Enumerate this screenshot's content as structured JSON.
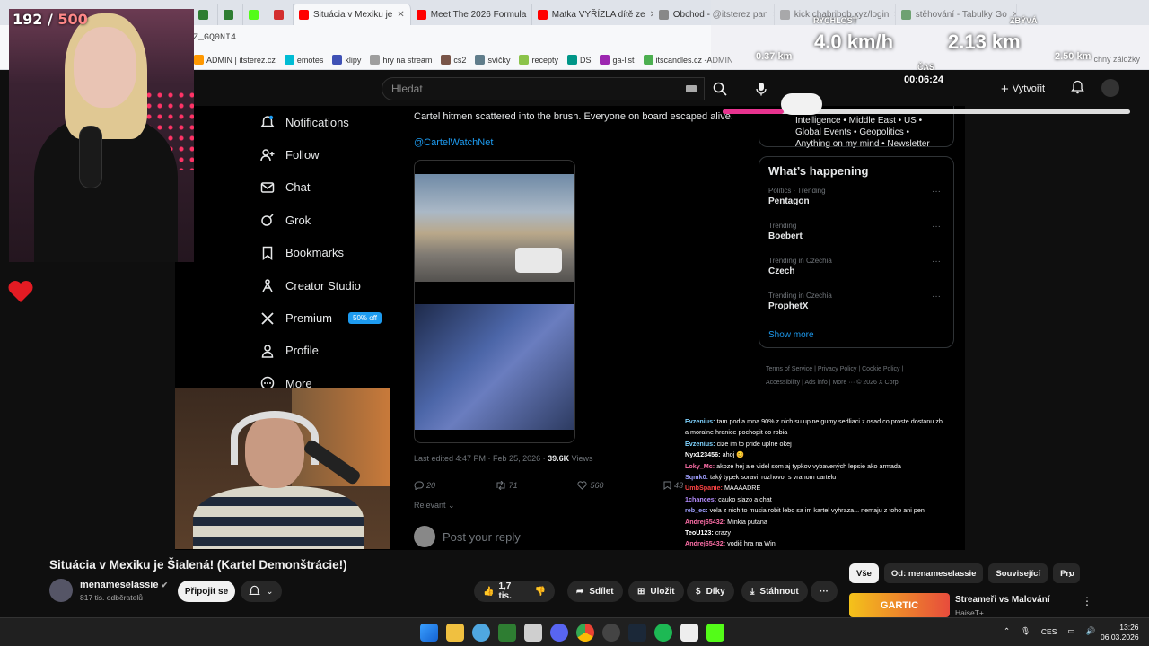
{
  "browser": {
    "tabs": [
      {
        "title": "",
        "color": "#2e7d32"
      },
      {
        "title": "",
        "color": "#2e7d32"
      },
      {
        "title": "",
        "color": "#53fc18"
      },
      {
        "title": "",
        "color": "#d32f2f"
      },
      {
        "title": "Situácia v Mexiku je",
        "color": "#ff0000",
        "active": true
      },
      {
        "title": "Meet The 2026 Formula",
        "color": "#ff0000"
      },
      {
        "title": "Matka VYŘÍZLA dítě ze",
        "color": "#ff0000"
      },
      {
        "title": "Obchod - @itsterez pan",
        "color": "#888888"
      },
      {
        "title": "kick.chabribob.xyz/login",
        "color": "#888888"
      },
      {
        "title": "stěhování - Tabulky Go",
        "color": "#2e7d32"
      }
    ],
    "url_fragment": "Z_GQ0NI4",
    "bookmarks": [
      "ADMIN | itsterez.cz",
      "emotes",
      "klipy",
      "hry na stream",
      "cs2",
      "svíčky",
      "recepty",
      "DS",
      "ga-list",
      "itscandles.cz -ADMIN"
    ],
    "bookmarks_other": "chny záložky"
  },
  "stream_overlay": {
    "counter_current": "192",
    "counter_sep": "/",
    "counter_max": "500",
    "speed_label": "RYCHLOST",
    "speed_value": "4.0 km/h",
    "remaining_label": "ZBÝVÁ",
    "remaining_value": "2.13 km",
    "distance_left": "0.37 km",
    "distance_right": "2.50 km",
    "time_label": "ČAS",
    "time_value": "00:06:24",
    "progress_fraction": 0.15
  },
  "youtube_header": {
    "search_placeholder": "Hledat",
    "create_label": "Vytvořit"
  },
  "x_nav": {
    "items": [
      {
        "label": "Notifications",
        "icon": "bell-icon"
      },
      {
        "label": "Follow",
        "icon": "follow-icon"
      },
      {
        "label": "Chat",
        "icon": "mail-icon"
      },
      {
        "label": "Grok",
        "icon": "grok-icon"
      },
      {
        "label": "Bookmarks",
        "icon": "bookmark-icon"
      },
      {
        "label": "Creator Studio",
        "icon": "creator-icon"
      },
      {
        "label": "Premium",
        "icon": "x-logo-icon",
        "badge": "50% off"
      },
      {
        "label": "Profile",
        "icon": "person-icon"
      },
      {
        "label": "More",
        "icon": "more-icon"
      }
    ]
  },
  "tweet": {
    "text": "Cartel hitmen scattered into the brush. Everyone on board escaped alive.",
    "handle": "@CartelWatchNet",
    "meta": "Last edited 4:47 PM · Feb 25, 2026 ·",
    "views": "39.6K",
    "views_label": "Views",
    "replies": "20",
    "reposts": "71",
    "likes": "560",
    "bookmarks": "43",
    "relevant": "Relevant",
    "reply_placeholder": "Post your reply"
  },
  "x_right": {
    "topic_text": "Intelligence • Middle East • US • Global Events • Geopolitics • Anything on my mind • Newsletter",
    "happening_title": "What’s happening",
    "trends": [
      {
        "category": "Politics · Trending",
        "name": "Pentagon"
      },
      {
        "category": "Trending",
        "name": "Boebert"
      },
      {
        "category": "Trending in Czechia",
        "name": "Czech"
      },
      {
        "category": "Trending in Czechia",
        "name": "ProphetX"
      }
    ],
    "show_more": "Show more",
    "footer_line1": "Terms of Service  |  Privacy Policy  |  Cookie Policy  |",
    "footer_line2": "Accessibility  |  Ads info  |  More ···  © 2026 X Corp."
  },
  "chat": [
    {
      "user": "Evzenius:",
      "msg": "tam podla mna 90% z nich su uplne gumy sedliaci z osad co proste dostanu zb",
      "color": "#7fd3ff"
    },
    {
      "user": "",
      "msg": "a moralne hranice pochopit co robia",
      "color": "#ffffff"
    },
    {
      "user": "Evzenius:",
      "msg": "cize im to pride uplne okej",
      "color": "#7fd3ff"
    },
    {
      "user": "Nyx123456:",
      "msg": "ahoj 😊",
      "color": "#ffffff"
    },
    {
      "user": "Loky_Mc:",
      "msg": "akoze hej ale videl som aj typkov vybavených lepsie ako armada",
      "color": "#ff6fa8"
    },
    {
      "user": "Sqmk0:",
      "msg": "taký typek soravil rozhovor s vrahom cartelu",
      "color": "#9f9fff"
    },
    {
      "user": "UmbSpanie:",
      "msg": "MAAAADRE",
      "color": "#ff4444"
    },
    {
      "user": "1chances:",
      "msg": "cauko slazo a chat",
      "color": "#b58cff"
    },
    {
      "user": "reb_ec:",
      "msg": "vela z nich to musia robit lebo sa im kartel vyhraza... nemaju z toho ani peni",
      "color": "#9f9fff"
    },
    {
      "user": "Andrej65432:",
      "msg": "Minkia putana",
      "color": "#ff6fa8"
    },
    {
      "user": "TeoU123:",
      "msg": "crazy",
      "color": "#ffffff"
    },
    {
      "user": "Andrej65432:",
      "msg": "vodič hra na Win",
      "color": "#ff6fa8"
    }
  ],
  "video_info": {
    "title": "Situácia v Mexiku je Šialená! (Kartel Demonštrácie!)",
    "channel": "menameselassie",
    "subscribers": "817 tis. odběratelů",
    "join": "Připojit se",
    "likes": "1,7 tis.",
    "share": "Sdílet",
    "save": "Uložit",
    "thanks": "Díky",
    "download": "Stáhnout"
  },
  "side_panel": {
    "chips": [
      "Vše",
      "Od: menameselassie",
      "Související",
      "Pro"
    ],
    "rec_thumb_text": "GARTIC",
    "rec_title": "Streameři vs Malování",
    "rec_channel": "HaiseT+"
  },
  "taskbar": {
    "lang": "CES",
    "time": "13:26",
    "date": "06.03.2026"
  }
}
